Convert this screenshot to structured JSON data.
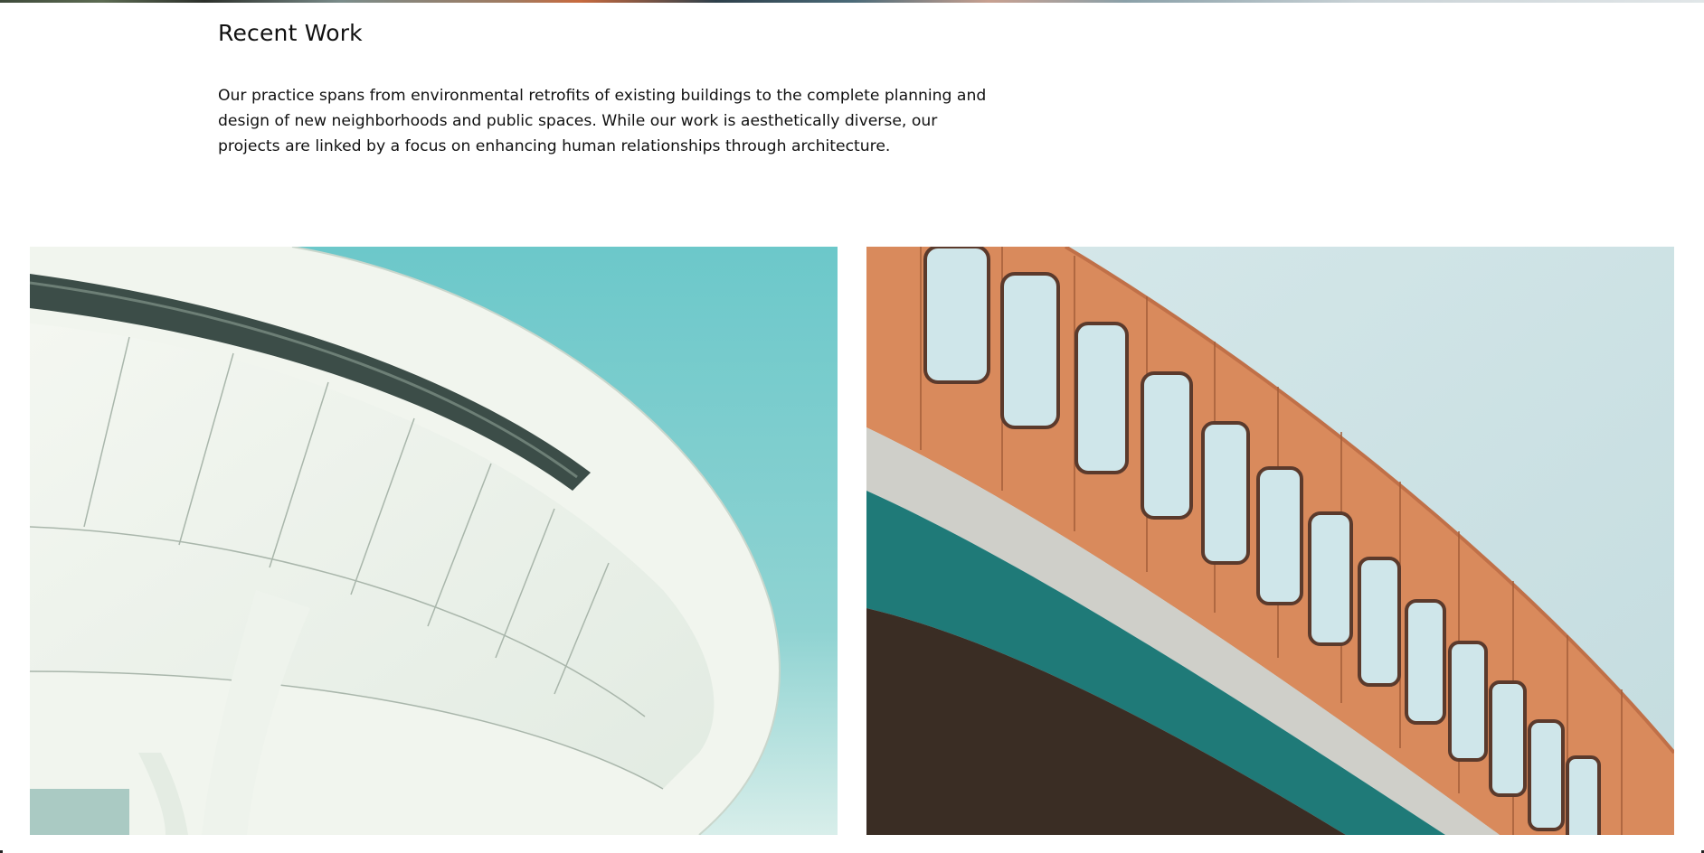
{
  "section": {
    "title": "Recent Work",
    "intro": "Our practice spans from environmental retrofits of existing buildings to the complete planning and design of new neighborhoods and public spaces. While our work is aesthetically diverse, our projects are linked by a focus on enhancing human relationships through architecture."
  },
  "colors": {
    "sky_teal": "#6ec9cc",
    "sky_pale": "#cfe3e6",
    "facade_orange": "#d98a5c",
    "band_teal": "#1f7a78",
    "concrete_white": "#eef3ea"
  },
  "images": [
    {
      "name": "project-photo-curved-white-building"
    },
    {
      "name": "project-photo-orange-teal-facade"
    }
  ]
}
